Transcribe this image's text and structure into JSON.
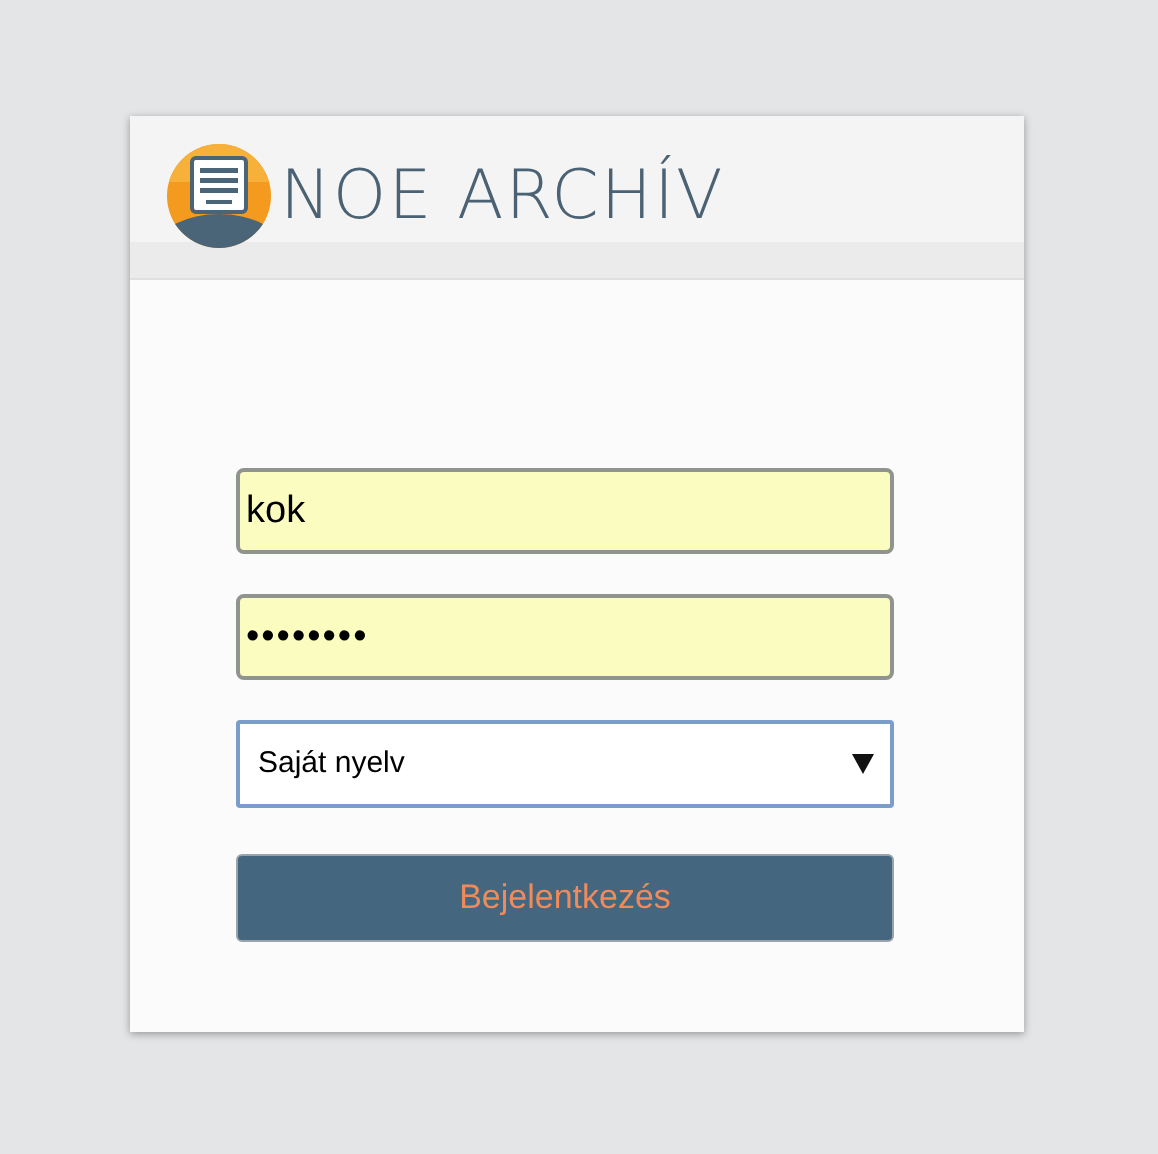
{
  "header": {
    "brand": "NOE ARCHÍV"
  },
  "login": {
    "username": {
      "value": "kok"
    },
    "password": {
      "value": "••••••••"
    },
    "language": {
      "value": "Saját nyelv",
      "focused": true
    },
    "submit": "Bejelentkezés"
  }
}
